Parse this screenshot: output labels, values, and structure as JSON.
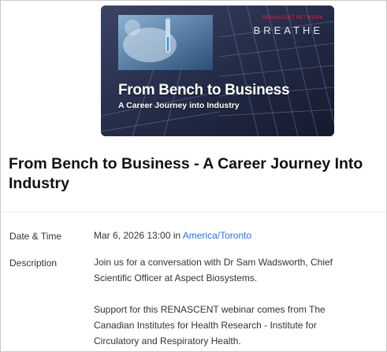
{
  "banner": {
    "logo_small": "RENASCENT NETWORK",
    "logo": "BREATHE",
    "title": "From Bench to Business",
    "subtitle": "A Career Journey into Industry"
  },
  "event": {
    "title": "From Bench to Business - A Career Journey Into Industry",
    "date_label": "Date & Time",
    "date_value": "Mar 6, 2026 13:00 in ",
    "timezone": "America/Toronto",
    "description_label": "Description",
    "description_p1": "Join us for a conversation with Dr Sam Wadsworth, Chief Scientific Officer at Aspect Biosystems.",
    "description_p2": "Support for this RENASCENT webinar comes from The Canadian Institutes for Health Research - Institute for Circulatory and Respiratory Health."
  },
  "colors": {
    "link": "#2f6fd6",
    "banner_dark": "#1a2038",
    "logo_accent": "#e0253a"
  }
}
